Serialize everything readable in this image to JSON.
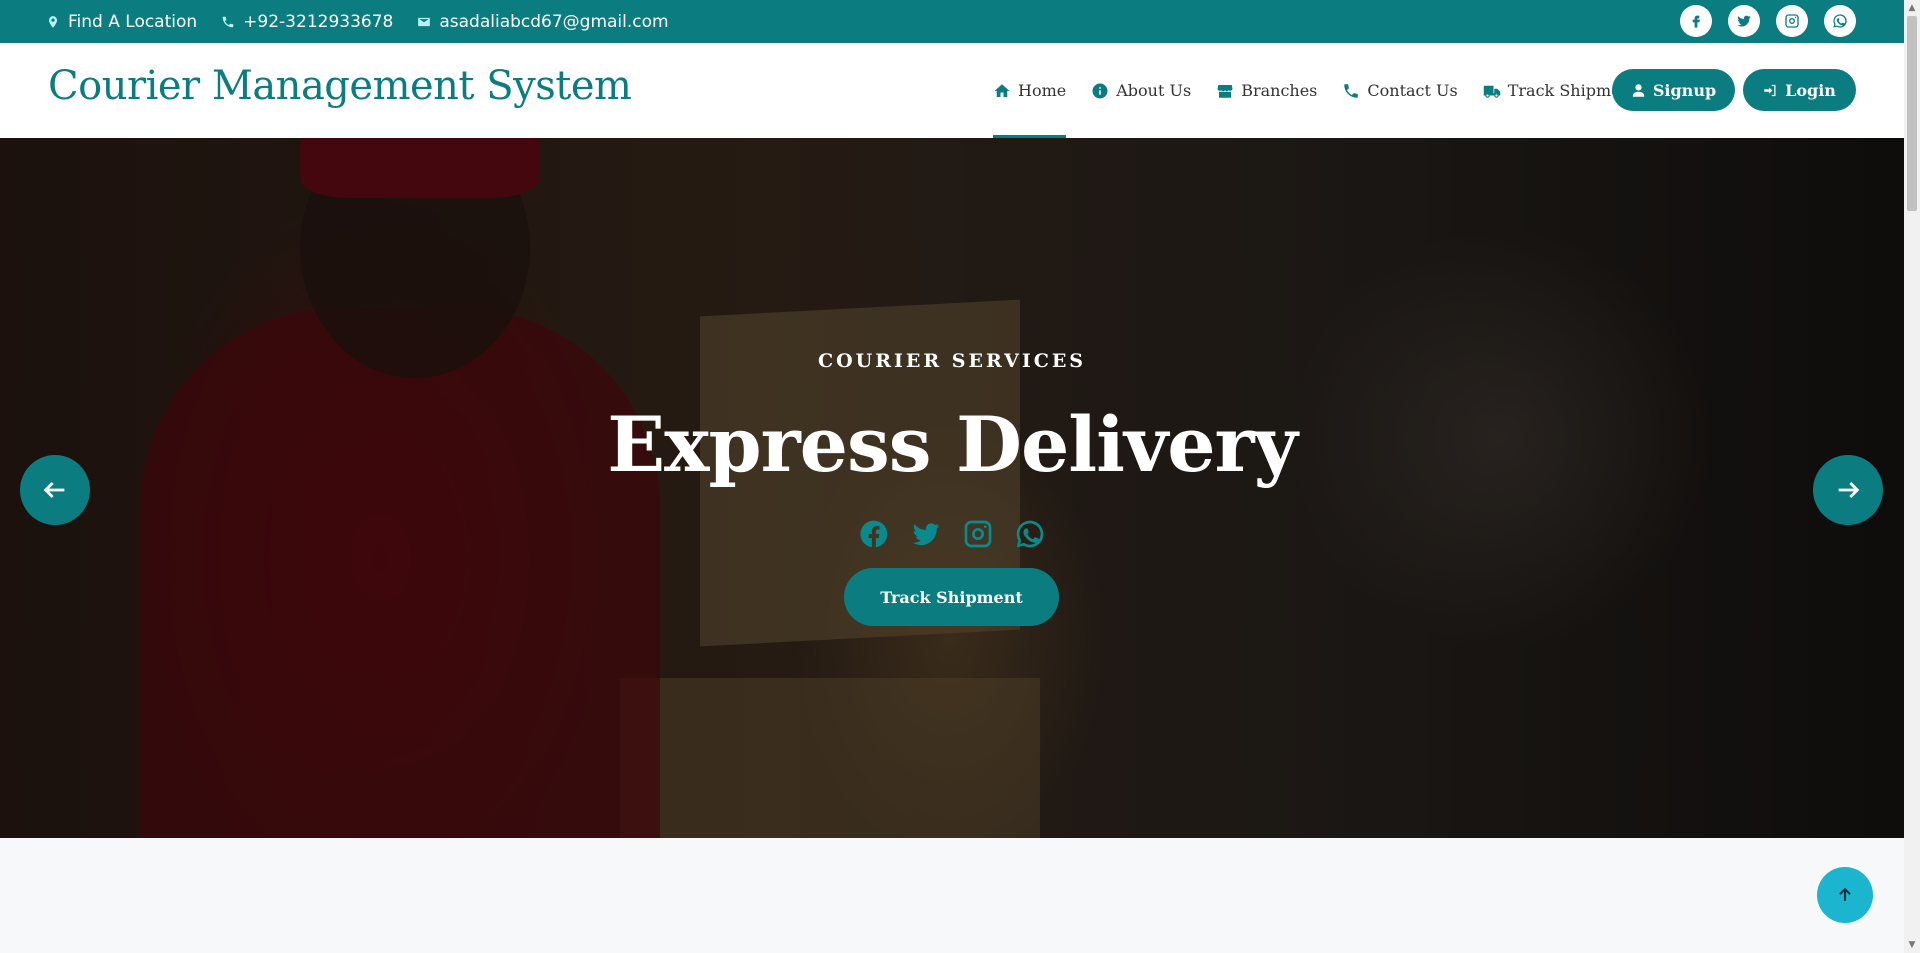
{
  "topbar": {
    "location": "Find A Location",
    "phone": "+92-3212933678",
    "email": "asadaliabcd67@gmail.com",
    "socials": [
      "facebook-icon",
      "twitter-icon",
      "instagram-icon",
      "whatsapp-icon"
    ]
  },
  "navbar": {
    "brand": "Courier Management System",
    "menu": [
      {
        "label": "Home",
        "icon": "home-icon",
        "active": true
      },
      {
        "label": "About Us",
        "icon": "info-icon"
      },
      {
        "label": "Branches",
        "icon": "store-icon"
      },
      {
        "label": "Contact Us",
        "icon": "phone-icon"
      },
      {
        "label": "Track Shipment",
        "icon": "truck-icon"
      }
    ],
    "signup_label": "Signup",
    "login_label": "Login"
  },
  "hero": {
    "subtitle": "COURIER SERVICES",
    "title": "Express Delivery",
    "button_label": "Track Shipment",
    "socials": [
      "facebook-icon",
      "twitter-icon",
      "instagram-icon",
      "whatsapp-icon"
    ]
  },
  "colors": {
    "primary": "#0b7d80",
    "back_to_top": "#1bb5cf"
  }
}
